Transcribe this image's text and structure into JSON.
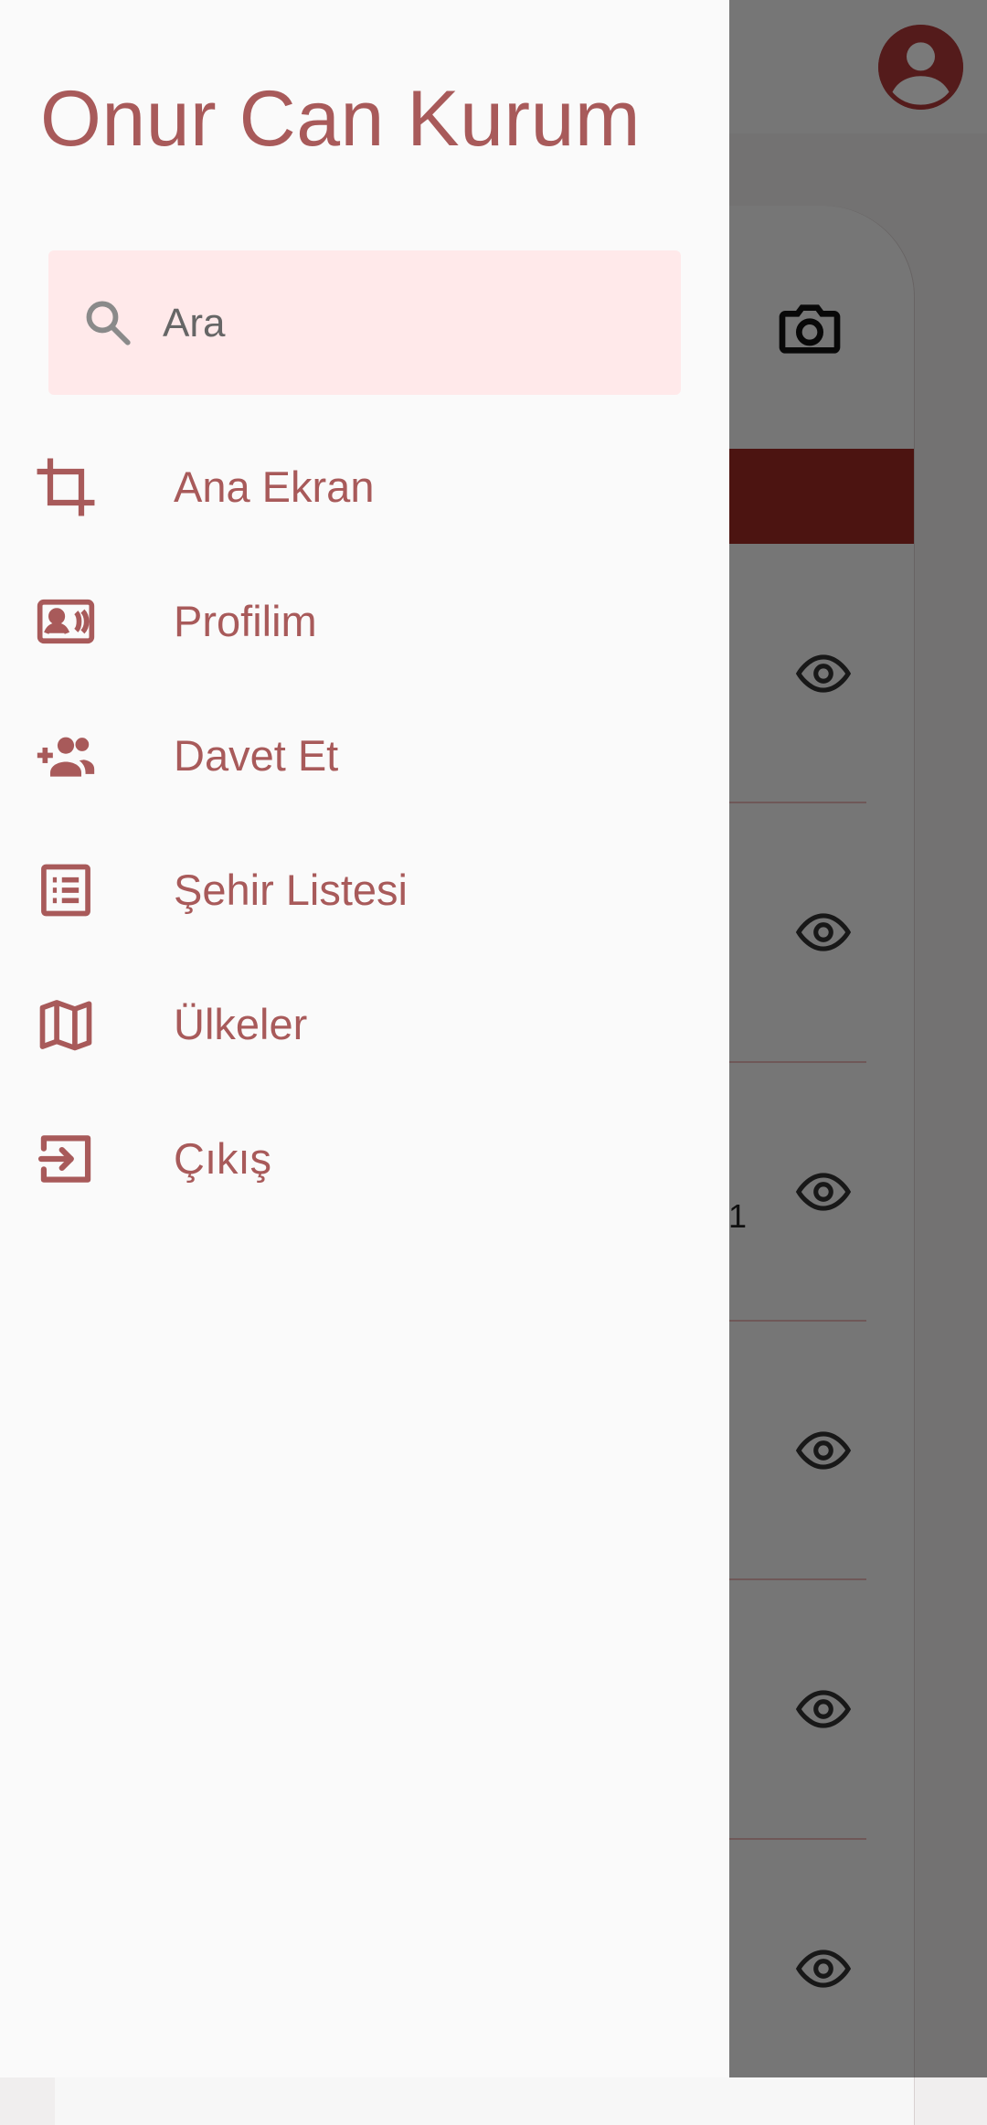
{
  "drawer": {
    "user_name": "Onur Can Kurum",
    "search": {
      "placeholder": "Ara",
      "value": "",
      "icon": "search-icon"
    },
    "items": [
      {
        "label": "Ana Ekran",
        "icon": "crop-icon"
      },
      {
        "label": "Profilim",
        "icon": "contact-card-icon"
      },
      {
        "label": "Davet Et",
        "icon": "group-add-icon"
      },
      {
        "label": "Şehir Listesi",
        "icon": "list-icon"
      },
      {
        "label": "Ülkeler",
        "icon": "map-icon"
      },
      {
        "label": "Çıkış",
        "icon": "logout-icon"
      }
    ]
  },
  "background": {
    "row_digit": "1",
    "icons": [
      "avatar-icon",
      "camera-icon",
      "eye-icon"
    ]
  },
  "colors": {
    "accent": "#a85a5a",
    "search_bg": "#ffe9ea",
    "brand_red": "#a02a24",
    "drawer_bg": "#fafafa"
  }
}
